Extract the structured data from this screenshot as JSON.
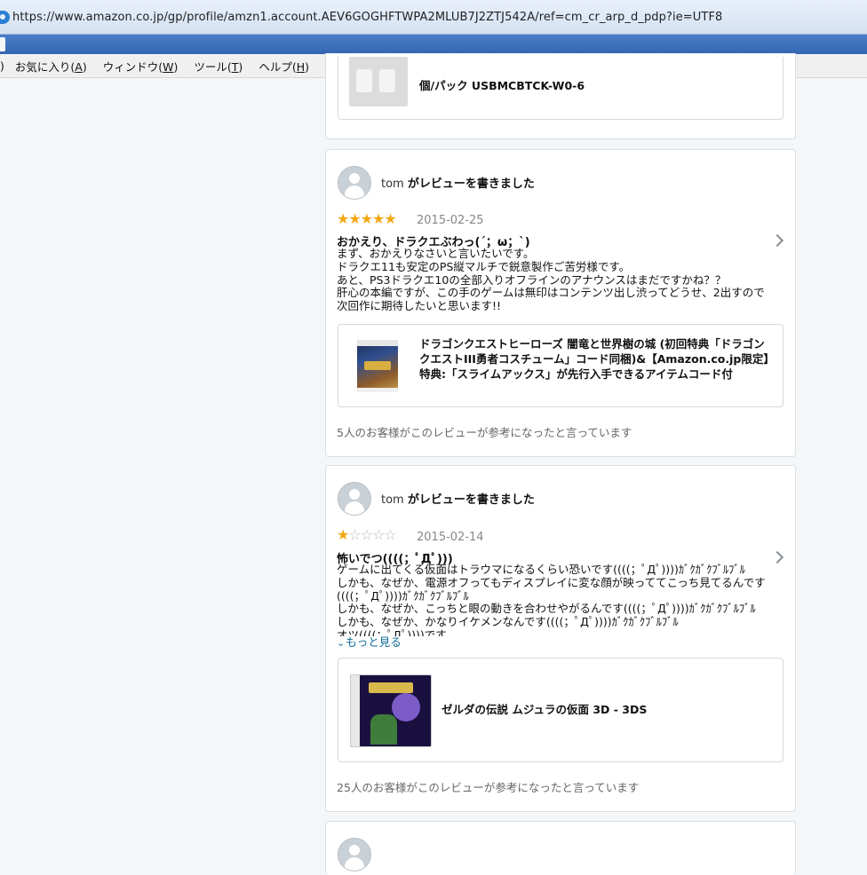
{
  "browser": {
    "url": "https://www.amazon.co.jp/gp/profile/amzn1.account.AEV6GOGHFTWPA2MLUB7J2ZTJ542A/ref=cm_cr_arp_d_pdp?ie=UTF8",
    "menu": [
      {
        "label": ")",
        "accel": ""
      },
      {
        "label": "お気に入り(",
        "accel": "A",
        "tail": ")"
      },
      {
        "label": "ウィンドウ(",
        "accel": "W",
        "tail": ")"
      },
      {
        "label": "ツール(",
        "accel": "T",
        "tail": ")"
      },
      {
        "label": "ヘルプ(",
        "accel": "H",
        "tail": ")"
      }
    ]
  },
  "prev_card": {
    "product_title": "個/パック USBMCBTCK-W0-6"
  },
  "reviews": [
    {
      "reviewer_name": "tom",
      "action": "がレビューを書きました",
      "stars": 5,
      "stars_text_on": "★★★★★",
      "stars_text_off": "",
      "date": "2015-02-25",
      "title": "おかえり、ドラクエぶわっ(´；ω；`)",
      "body": "まず、おかえりなさいと言いたいです。\nドラクエ11も安定のPS縦マルチで鋭意製作ご苦労様です。\nあと、PS3ドラクエ10の全部入りオフラインのアナウンスはまだですかね？？\n肝心の本編ですが、この手のゲームは無印はコンテンツ出し渋ってどうせ、2出すので次回作に期待したいと思います!!",
      "product_title": "ドラゴンクエストヒーローズ 闇竜と世界樹の城 (初回特典「ドラゴンクエストIII勇者コスチューム」コード同梱)&【Amazon.co.jp限定】特典:「スライムアックス」が先行入手できるアイテムコード付",
      "helpful": "5人のお客様がこのレビューが参考になったと言っています"
    },
    {
      "reviewer_name": "tom",
      "action": "がレビューを書きました",
      "stars": 1,
      "stars_text_on": "★",
      "stars_text_off": "☆☆☆☆",
      "date": "2015-02-14",
      "title": "怖いでつ((((；ﾟДﾟ)))",
      "body": "ゲームに出てくる仮面はトラウマになるくらい恐いです((((；ﾟДﾟ))))ｶﾞｸｶﾞｸﾌﾞﾙﾌﾞﾙ\nしかも、なぜか、電源オフってもディスプレイに変な顔が映っててこっち見てるんです((((；ﾟДﾟ))))ｶﾞｸｶﾞｸﾌﾞﾙﾌﾞﾙ\nしかも、なぜか、こっちと眼の動きを合わせやがるんです((((；ﾟДﾟ))))ｶﾞｸｶﾞｸﾌﾞﾙﾌﾞﾙ\nしかも、なぜか、かなりイケメンなんです((((；ﾟДﾟ))))ｶﾞｸｶﾞｸﾌﾞﾙﾌﾞﾙ\nオツ((((；ﾟДﾟ))))です",
      "more_label": "もっと見る",
      "product_title": "ゼルダの伝説 ムジュラの仮面 3D - 3DS",
      "helpful": "25人のお客様がこのレビューが参考になったと言っています"
    }
  ],
  "colors": {
    "star": "#f3a712",
    "star_off": "#b9b9b9",
    "link": "#0f6b99",
    "titlebar_blue": "#3366b2"
  }
}
